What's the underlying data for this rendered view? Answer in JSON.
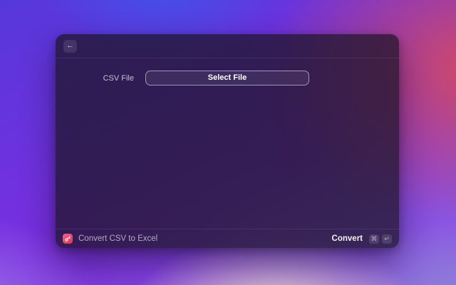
{
  "window": {
    "header": {
      "back_icon": "←"
    },
    "form": {
      "csv_file_label": "CSV File",
      "select_file_button": "Select File"
    },
    "footer": {
      "command_title": "Convert CSV to Excel",
      "primary_action": "Convert",
      "shortcut_keys": [
        "⌘",
        "↵"
      ],
      "extension_icon": "key-icon",
      "extension_icon_colors": {
        "gradient_start": "#ef6292",
        "gradient_end": "#dd3750"
      }
    }
  }
}
